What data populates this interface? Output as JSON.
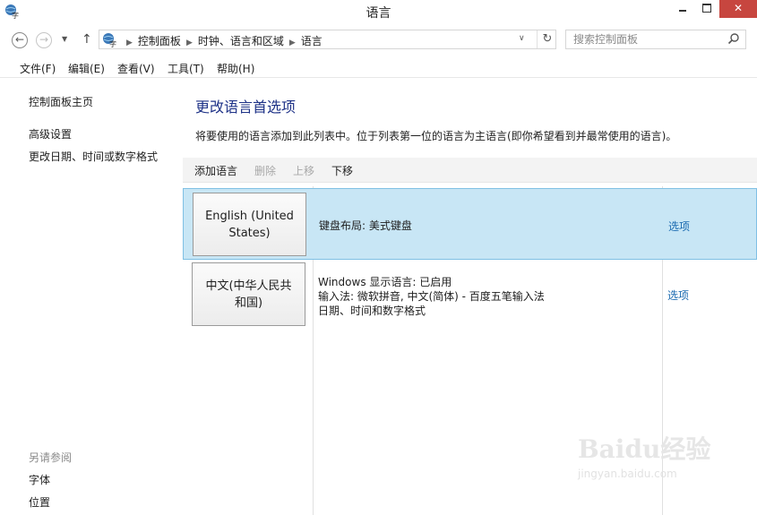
{
  "window": {
    "title": "语言"
  },
  "address_bar": {
    "crumbs": [
      "控制面板",
      "时钟、语言和区域",
      "语言"
    ]
  },
  "search": {
    "placeholder": "搜索控制面板"
  },
  "menu": [
    "文件(F)",
    "编辑(E)",
    "查看(V)",
    "工具(T)",
    "帮助(H)"
  ],
  "left_nav": {
    "home": "控制面板主页",
    "links": [
      "高级设置",
      "更改日期、时间或数字格式"
    ],
    "see_also_title": "另请参阅",
    "see_also": [
      "字体",
      "位置"
    ]
  },
  "main": {
    "heading": "更改语言首选项",
    "description": "将要使用的语言添加到此列表中。位于列表第一位的语言为主语言(即你希望看到并最常使用的语言)。",
    "toolbar": {
      "add": "添加语言",
      "remove": "删除",
      "up": "上移",
      "down": "下移"
    },
    "languages": [
      {
        "name": "English (United States)",
        "details": [
          "键盘布局: 美式键盘"
        ],
        "options": "选项",
        "selected": true
      },
      {
        "name": "中文(中华人民共和国)",
        "details": [
          "Windows 显示语言: 已启用",
          "输入法: 微软拼音, 中文(简体) - 百度五笔输入法",
          "日期、时间和数字格式"
        ],
        "options": "选项",
        "selected": false
      }
    ]
  },
  "watermark": {
    "brand": "Baidu经验",
    "url": "jingyan.baidu.com"
  },
  "colors": {
    "heading": "#1e3287",
    "selected_row": "#c8e6f5",
    "link": "#1a6ab0",
    "close": "#c7463f"
  }
}
